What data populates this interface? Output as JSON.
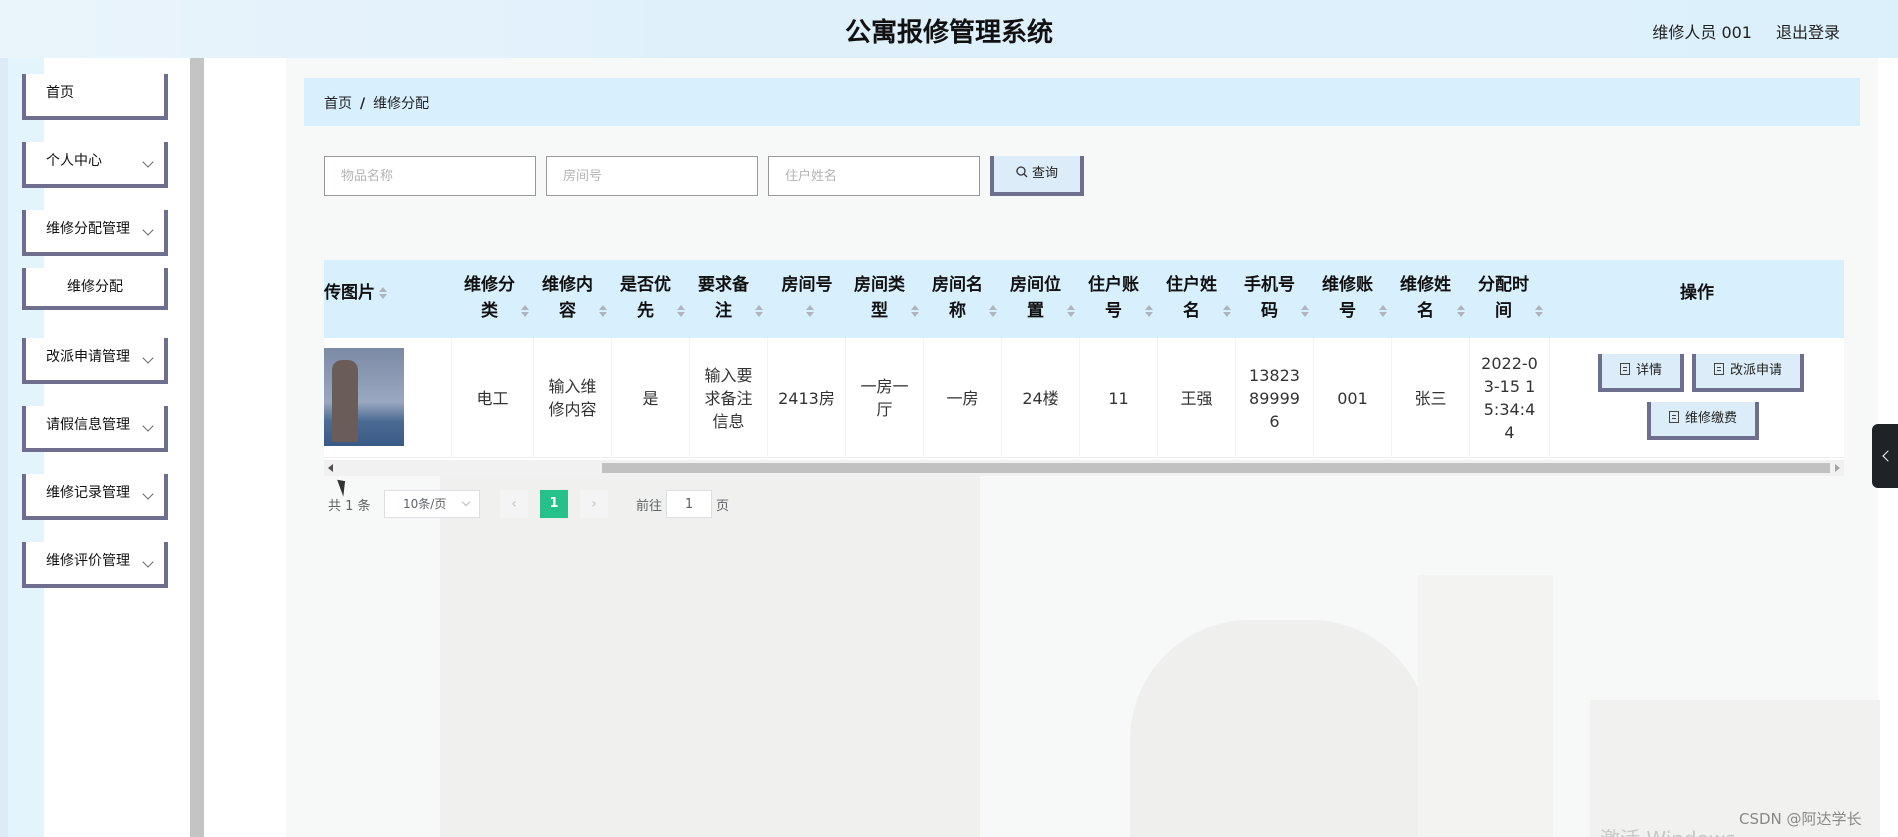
{
  "app": {
    "title": "公寓报修管理系统",
    "user": "维修人员 001",
    "logout": "退出登录"
  },
  "sidebar": {
    "items": [
      {
        "label": "首页"
      },
      {
        "label": "个人中心"
      },
      {
        "label": "维修分配管理"
      },
      {
        "label": "维修分配"
      },
      {
        "label": "改派申请管理"
      },
      {
        "label": "请假信息管理"
      },
      {
        "label": "维修记录管理"
      },
      {
        "label": "维修评价管理"
      }
    ]
  },
  "breadcrumb": {
    "home": "首页",
    "sep": "/",
    "current": "维修分配"
  },
  "search": {
    "item_placeholder": "物品名称",
    "room_placeholder": "房间号",
    "resident_placeholder": "住户姓名",
    "button": "查询"
  },
  "table": {
    "headers": {
      "photo": "传图片",
      "category": "维修分类",
      "content": "维修内容",
      "priority": "是否优先",
      "remark": "要求备注",
      "room_no": "房间号",
      "room_type": "房间类型",
      "room_name": "房间名称",
      "room_loc": "房间位置",
      "account": "住户账号",
      "resident": "住户姓名",
      "phone": "手机号码",
      "worker_acct": "维修账号",
      "worker_name": "维修姓名",
      "assign_time": "分配时间",
      "actions": "操作"
    },
    "rows": [
      {
        "category": "电工",
        "content": "输入维修内容",
        "priority": "是",
        "remark": "输入要求备注信息",
        "room_no": "2413房",
        "room_type": "一房一厅",
        "room_name": "一房",
        "room_loc": "24楼",
        "account": "11",
        "resident": "王强",
        "phone": "13823899996",
        "worker_acct": "001",
        "worker_name": "张三",
        "assign_time": "2022-03-15 15:34:44",
        "actions": {
          "detail": "详情",
          "reassign": "改派申请",
          "pay": "维修缴费"
        }
      }
    ]
  },
  "pagination": {
    "total": "共 1 条",
    "page_size": "10条/页",
    "current": "1",
    "goto_label": "前往",
    "goto_value": "1",
    "page_suffix": "页"
  },
  "watermark": "CSDN @阿达学长",
  "os_notice": "激活 Windows"
}
